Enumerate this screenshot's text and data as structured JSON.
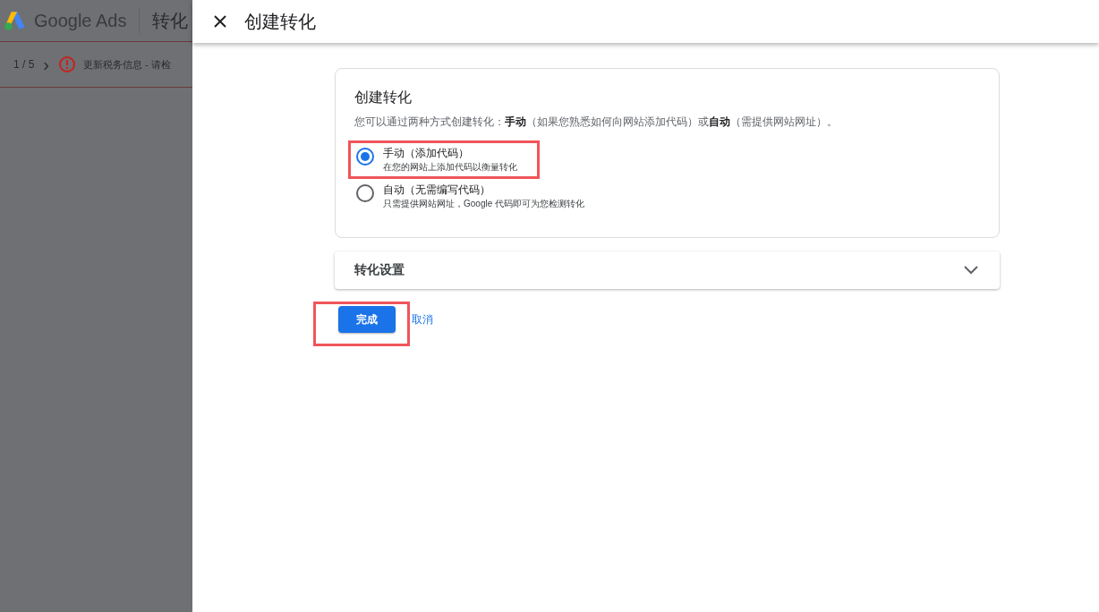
{
  "background_app": {
    "brand": "Google Ads",
    "page_title": "转化",
    "notice": {
      "counter": "1 / 5",
      "next": "›",
      "text": "更新税务信息 - 请检"
    }
  },
  "drawer": {
    "title": "创建转化",
    "card": {
      "heading": "创建转化",
      "intro": "您可以通过两种方式创建转化：**手动**（如果您熟悉如何向网站添加代码）或**自动**（需提供网站网址）。",
      "options": [
        {
          "label": "手动（添加代码）",
          "description": "在您的网站上添加代码以衡量转化",
          "selected": true,
          "highlighted": true
        },
        {
          "label": "自动（无需编写代码）",
          "description": "只需提供网站网址，Google 代码即可为您检测转化",
          "selected": false,
          "highlighted": false
        }
      ]
    },
    "settings_panel": {
      "title": "转化设置",
      "expanded": false
    },
    "buttons": [
      {
        "label": "完成",
        "kind": "primary",
        "highlighted": true
      },
      {
        "label": "取消",
        "kind": "text",
        "highlighted": false
      }
    ]
  }
}
